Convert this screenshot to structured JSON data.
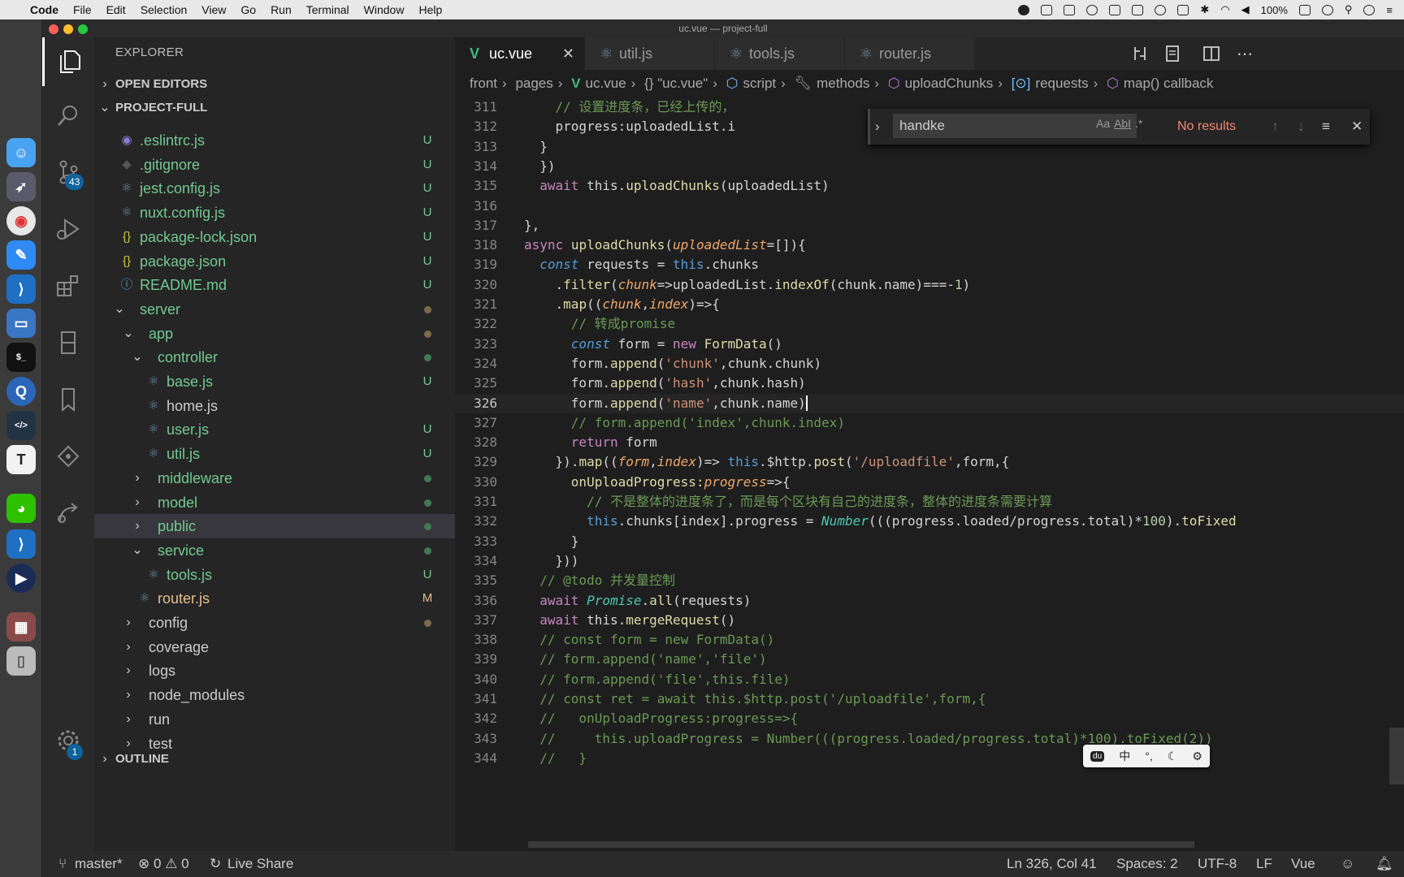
{
  "menubar": {
    "app": "Code",
    "items": [
      "File",
      "Edit",
      "Selection",
      "View",
      "Go",
      "Run",
      "Terminal",
      "Window",
      "Help"
    ],
    "battery": "100%"
  },
  "window": {
    "title": "uc.vue — project-full"
  },
  "activity": {
    "scm_badge": "43",
    "settings_badge": "1"
  },
  "explorer": {
    "title": "EXPLORER",
    "open_editors": "OPEN EDITORS",
    "project": "PROJECT-FULL",
    "outline": "OUTLINE",
    "rows": [
      {
        "label": ".eslintrc.js",
        "status": "U",
        "icon": "eslint-icon",
        "depth": 0,
        "kind": "file"
      },
      {
        "label": ".gitignore",
        "status": "U",
        "icon": "git-icon",
        "depth": 0,
        "kind": "file"
      },
      {
        "label": "jest.config.js",
        "status": "U",
        "icon": "react-icon",
        "depth": 0,
        "kind": "file"
      },
      {
        "label": "nuxt.config.js",
        "status": "U",
        "icon": "react-icon",
        "depth": 0,
        "kind": "file"
      },
      {
        "label": "package-lock.json",
        "status": "U",
        "icon": "json-icon",
        "depth": 0,
        "kind": "file"
      },
      {
        "label": "package.json",
        "status": "U",
        "icon": "json-icon",
        "depth": 0,
        "kind": "file"
      },
      {
        "label": "README.md",
        "status": "U",
        "icon": "info-icon",
        "depth": 0,
        "kind": "file"
      },
      {
        "label": "server",
        "status": "",
        "icon": "",
        "depth": 0,
        "kind": "open"
      },
      {
        "label": "app",
        "status": "",
        "icon": "",
        "depth": 1,
        "kind": "open"
      },
      {
        "label": "controller",
        "status": "",
        "icon": "",
        "depth": 2,
        "kind": "open"
      },
      {
        "label": "base.js",
        "status": "U",
        "icon": "react-icon",
        "depth": 3,
        "kind": "file"
      },
      {
        "label": "home.js",
        "status": "",
        "icon": "react-icon",
        "depth": 3,
        "kind": "file"
      },
      {
        "label": "user.js",
        "status": "U",
        "icon": "react-icon",
        "depth": 3,
        "kind": "file"
      },
      {
        "label": "util.js",
        "status": "U",
        "icon": "react-icon",
        "depth": 3,
        "kind": "file"
      },
      {
        "label": "middleware",
        "status": "",
        "icon": "",
        "depth": 2,
        "kind": "closed"
      },
      {
        "label": "model",
        "status": "",
        "icon": "",
        "depth": 2,
        "kind": "closed"
      },
      {
        "label": "public",
        "status": "",
        "icon": "",
        "depth": 2,
        "kind": "closed",
        "selected": true
      },
      {
        "label": "service",
        "status": "",
        "icon": "",
        "depth": 2,
        "kind": "open"
      },
      {
        "label": "tools.js",
        "status": "U",
        "icon": "react-icon",
        "depth": 3,
        "kind": "file"
      },
      {
        "label": "router.js",
        "status": "M",
        "icon": "react-icon",
        "depth": 2,
        "kind": "file"
      },
      {
        "label": "config",
        "status": "",
        "icon": "",
        "depth": 1,
        "kind": "closed"
      },
      {
        "label": "coverage",
        "status": "",
        "icon": "",
        "depth": 1,
        "kind": "closed"
      },
      {
        "label": "logs",
        "status": "",
        "icon": "",
        "depth": 1,
        "kind": "closed"
      },
      {
        "label": "node_modules",
        "status": "",
        "icon": "",
        "depth": 1,
        "kind": "closed"
      },
      {
        "label": "run",
        "status": "",
        "icon": "",
        "depth": 1,
        "kind": "closed"
      },
      {
        "label": "test",
        "status": "",
        "icon": "",
        "depth": 1,
        "kind": "closed"
      }
    ]
  },
  "tabs": [
    {
      "label": "uc.vue",
      "active": true,
      "close": "✕"
    },
    {
      "label": "util.js",
      "active": false
    },
    {
      "label": "tools.js",
      "active": false
    },
    {
      "label": "router.js",
      "active": false
    }
  ],
  "breadcrumb": [
    "front",
    "pages",
    "uc.vue",
    "{} \"uc.vue\"",
    "script",
    "methods",
    "uploadChunks",
    "requests",
    "map() callback"
  ],
  "find": {
    "query": "handke",
    "result": "No results",
    "opt_case": "Aa",
    "opt_word": "AbI",
    "opt_regex": ".*"
  },
  "code": {
    "first_line": 311,
    "current_line": 326,
    "lines": [
      [
        [
          "    // 设置进度条，已经上传的，",
          "c"
        ]
      ],
      [
        [
          "    progress:uploadedList.i",
          "p"
        ]
      ],
      [
        [
          "  }",
          "p"
        ]
      ],
      [
        [
          "  })",
          "p"
        ]
      ],
      [
        [
          "  ",
          "p"
        ],
        [
          "await",
          "k"
        ],
        [
          " this.",
          "p"
        ],
        [
          "uploadChunks",
          "f"
        ],
        [
          "(uploadedList)",
          "p"
        ]
      ],
      [
        [
          "",
          "p"
        ]
      ],
      [
        [
          "},",
          "p"
        ]
      ],
      [
        [
          "async",
          "k"
        ],
        [
          " ",
          "p"
        ],
        [
          "uploadChunks",
          "f"
        ],
        [
          "(",
          "p"
        ],
        [
          "uploadedList",
          "a"
        ],
        [
          "=[]){",
          "p"
        ]
      ],
      [
        [
          "  ",
          "p"
        ],
        [
          "const",
          "s"
        ],
        [
          " requests = ",
          "p"
        ],
        [
          "this",
          "s"
        ],
        [
          ".chunks",
          "p"
        ]
      ],
      [
        [
          "    .",
          "p"
        ],
        [
          "filter",
          "f"
        ],
        [
          "(",
          "p"
        ],
        [
          "chunk",
          "a"
        ],
        [
          "=>uploadedList.",
          "p"
        ],
        [
          "indexOf",
          "f"
        ],
        [
          "(chunk.name)===-",
          "p"
        ],
        [
          "1",
          "n"
        ],
        [
          ")",
          "p"
        ]
      ],
      [
        [
          "    .",
          "p"
        ],
        [
          "map",
          "f"
        ],
        [
          "((",
          "p"
        ],
        [
          "chunk",
          "a"
        ],
        [
          ",",
          "p"
        ],
        [
          "index",
          "a"
        ],
        [
          ")=>{",
          "p"
        ]
      ],
      [
        [
          "      // 转成promise",
          "c"
        ]
      ],
      [
        [
          "      ",
          "p"
        ],
        [
          "const",
          "s"
        ],
        [
          " form = ",
          "p"
        ],
        [
          "new",
          "k"
        ],
        [
          " ",
          "p"
        ],
        [
          "FormData",
          "f"
        ],
        [
          "()",
          "p"
        ]
      ],
      [
        [
          "      form.",
          "p"
        ],
        [
          "append",
          "f"
        ],
        [
          "(",
          "p"
        ],
        [
          "'chunk'",
          "str"
        ],
        [
          ",chunk.chunk)",
          "p"
        ]
      ],
      [
        [
          "      form.",
          "p"
        ],
        [
          "append",
          "f"
        ],
        [
          "(",
          "p"
        ],
        [
          "'hash'",
          "str"
        ],
        [
          ",chunk.hash)",
          "p"
        ]
      ],
      [
        [
          "      form.",
          "p"
        ],
        [
          "append",
          "f"
        ],
        [
          "(",
          "p"
        ],
        [
          "'name'",
          "str"
        ],
        [
          ",chunk.name)",
          "p"
        ]
      ],
      [
        [
          "      // form.append('index',chunk.index)",
          "c"
        ]
      ],
      [
        [
          "      ",
          "p"
        ],
        [
          "return",
          "k"
        ],
        [
          " form",
          "p"
        ]
      ],
      [
        [
          "    }).",
          "p"
        ],
        [
          "map",
          "f"
        ],
        [
          "((",
          "p"
        ],
        [
          "form",
          "a"
        ],
        [
          ",",
          "p"
        ],
        [
          "index",
          "a"
        ],
        [
          ")=> ",
          "p"
        ],
        [
          "this",
          "s"
        ],
        [
          ".$http.",
          "p"
        ],
        [
          "post",
          "f"
        ],
        [
          "(",
          "p"
        ],
        [
          "'/uploadfile'",
          "str"
        ],
        [
          ",form,{",
          "p"
        ]
      ],
      [
        [
          "      onUploadProgress:",
          "f"
        ],
        [
          "progress",
          "a"
        ],
        [
          "=>{",
          "p"
        ]
      ],
      [
        [
          "        // 不是整体的进度条了，而是每个区块有自己的进度条，整体的进度条需要计算",
          "c"
        ]
      ],
      [
        [
          "        ",
          "p"
        ],
        [
          "this",
          "s"
        ],
        [
          ".chunks[index].progress = ",
          "p"
        ],
        [
          "Number",
          "t"
        ],
        [
          "(((progress.loaded/progress.total)*",
          "p"
        ],
        [
          "100",
          "n"
        ],
        [
          ").",
          "p"
        ],
        [
          "toFixed",
          "f"
        ]
      ],
      [
        [
          "      }",
          "p"
        ]
      ],
      [
        [
          "    }))",
          "p"
        ]
      ],
      [
        [
          "  // @todo 并发量控制",
          "c"
        ]
      ],
      [
        [
          "  ",
          "p"
        ],
        [
          "await",
          "k"
        ],
        [
          " ",
          "p"
        ],
        [
          "Promise",
          "t"
        ],
        [
          ".",
          "p"
        ],
        [
          "all",
          "f"
        ],
        [
          "(requests)",
          "p"
        ]
      ],
      [
        [
          "  ",
          "p"
        ],
        [
          "await",
          "k"
        ],
        [
          " this.",
          "p"
        ],
        [
          "mergeRequest",
          "f"
        ],
        [
          "()",
          "p"
        ]
      ],
      [
        [
          "  // const form = new FormData()",
          "c"
        ]
      ],
      [
        [
          "  // form.append('name','file')",
          "c"
        ]
      ],
      [
        [
          "  // form.append('file',this.file)",
          "c"
        ]
      ],
      [
        [
          "  // const ret = await this.$http.post('/uploadfile',form,{",
          "c"
        ]
      ],
      [
        [
          "  //   onUploadProgress:progress=>{",
          "c"
        ]
      ],
      [
        [
          "  //     this.uploadProgress = Number(((progress.loaded/progress.total)*100).toFixed(2))",
          "c"
        ]
      ],
      [
        [
          "  //   }",
          "c"
        ]
      ]
    ]
  },
  "ime": [
    "中",
    "°,",
    "☾",
    "⚙"
  ],
  "status": {
    "branch": "master*",
    "problems": "⊗ 0 ⚠ 0",
    "liveshare": "Live Share",
    "position": "Ln 326, Col 41",
    "spaces": "Spaces: 2",
    "encoding": "UTF-8",
    "eol": "LF",
    "language": "Vue"
  },
  "colors": {
    "keyword": "#c586c0",
    "storage": "#569cd6",
    "function": "#dcdcaa",
    "param": "#f0a86a",
    "string": "#ce9178",
    "comment": "#6a9955",
    "number": "#b5cea8",
    "type": "#4ec9b0",
    "plain": "#d4d4d4",
    "added": "#73c991",
    "modified": "#e2c08d"
  }
}
